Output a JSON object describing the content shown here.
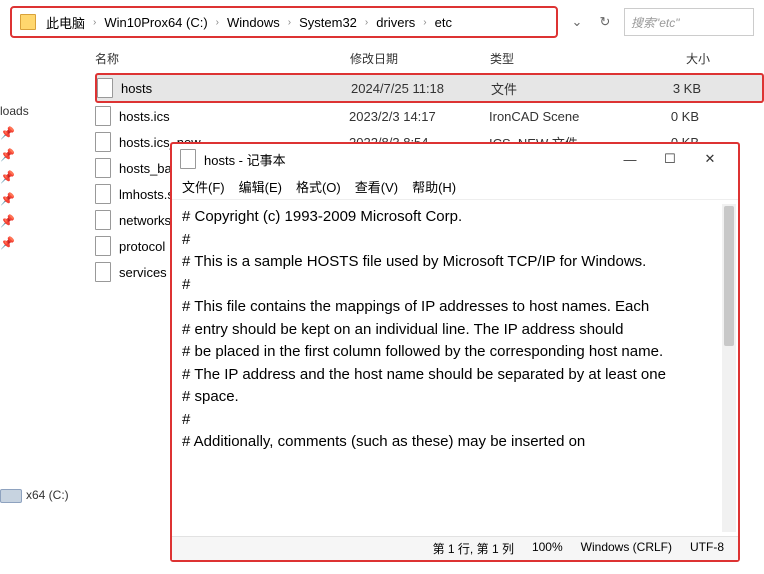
{
  "breadcrumb": [
    "此电脑",
    "Win10Prox64 (C:)",
    "Windows",
    "System32",
    "drivers",
    "etc"
  ],
  "search": {
    "placeholder": "搜索\"etc\""
  },
  "columns": {
    "name": "名称",
    "date": "修改日期",
    "type": "类型",
    "size": "大小"
  },
  "sidebar": {
    "items": [
      "loads"
    ],
    "drive": "x64 (C:)"
  },
  "files": [
    {
      "name": "hosts",
      "date": "2024/7/25 11:18",
      "type": "文件",
      "size": "3 KB",
      "selected": true
    },
    {
      "name": "hosts.ics",
      "date": "2023/2/3 14:17",
      "type": "IronCAD Scene",
      "size": "0 KB"
    },
    {
      "name": "hosts.ics_new",
      "date": "2022/8/3 8:54",
      "type": "ICS_NEW 文件",
      "size": "0 KB"
    },
    {
      "name": "hosts_ba"
    },
    {
      "name": "lmhosts.s"
    },
    {
      "name": "networks"
    },
    {
      "name": "protocol"
    },
    {
      "name": "services"
    }
  ],
  "notepad": {
    "title": "hosts - 记事本",
    "menu": {
      "file": "文件(F)",
      "edit": "编辑(E)",
      "format": "格式(O)",
      "view": "查看(V)",
      "help": "帮助(H)"
    },
    "content": [
      "# Copyright (c) 1993-2009 Microsoft Corp.",
      "#",
      "# This is a sample HOSTS file used by Microsoft TCP/IP for Windows.",
      "#",
      "# This file contains the mappings of IP addresses to host names. Each",
      "# entry should be kept on an individual line. The IP address should",
      "# be placed in the first column followed by the corresponding host name.",
      "# The IP address and the host name should be separated by at least one",
      "# space.",
      "#",
      "# Additionally, comments (such as these) may be inserted on"
    ],
    "status": {
      "pos": "第 1 行, 第 1 列",
      "zoom": "100%",
      "eol": "Windows (CRLF)",
      "enc": "UTF-8"
    }
  }
}
